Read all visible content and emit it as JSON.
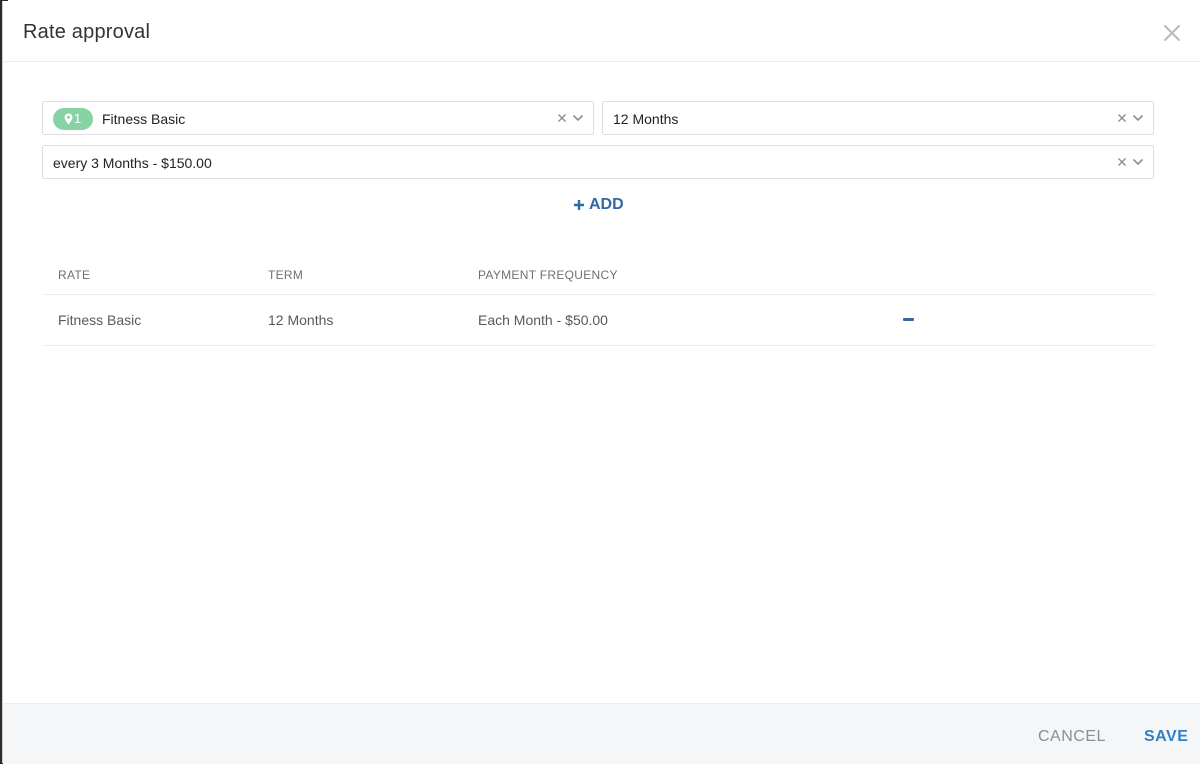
{
  "modal": {
    "title": "Rate approval",
    "close_icon": "close-icon"
  },
  "form": {
    "rate_select": {
      "badge_icon": "location-pin-icon",
      "badge_count": "1",
      "badge_color": "#88d3a3",
      "value": "Fitness Basic"
    },
    "term_select": {
      "value": "12 Months"
    },
    "frequency_select": {
      "value": "every 3 Months - $150.00"
    },
    "add_label": "ADD",
    "add_icon": "plus-icon"
  },
  "table": {
    "headers": [
      "RATE",
      "TERM",
      "PAYMENT FREQUENCY"
    ],
    "rows": [
      {
        "rate": "Fitness Basic",
        "term": "12 Months",
        "payment_frequency": "Each Month - $50.00",
        "remove_icon": "minus-icon"
      }
    ]
  },
  "footer": {
    "cancel_label": "CANCEL",
    "save_label": "SAVE"
  },
  "colors": {
    "accent": "#2f6aa7",
    "save": "#2f7fc1",
    "badge": "#88d3a3"
  }
}
